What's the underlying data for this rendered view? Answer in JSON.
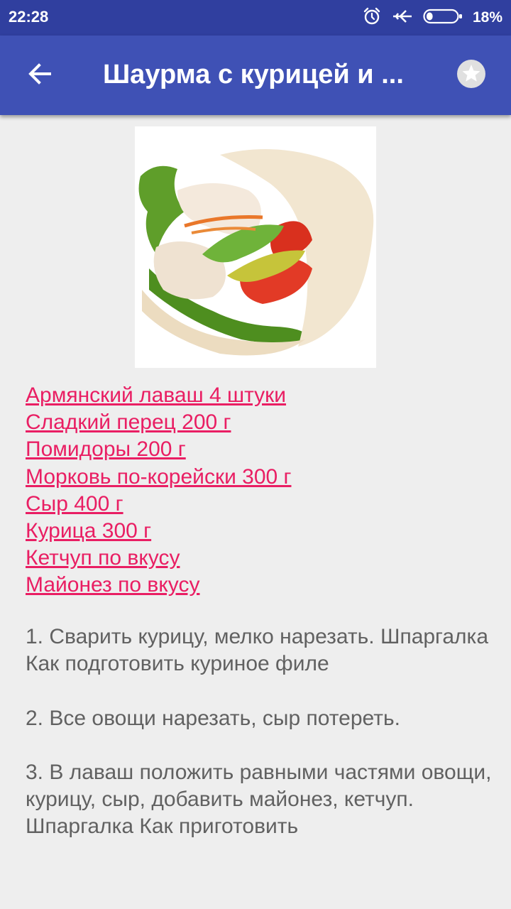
{
  "status_bar": {
    "time": "22:28",
    "battery_percent": "18%",
    "icons": [
      "alarm-icon",
      "airplane-mode-icon",
      "battery-icon"
    ],
    "battery_level": 0.18
  },
  "toolbar": {
    "back_icon": "arrow-back-icon",
    "title": "Шаурма с курицей и ...",
    "favorite_icon": "star-icon"
  },
  "recipe": {
    "image_alt": "shawarma-photo",
    "ingredients": [
      "Армянский лаваш 4 штуки",
      "Сладкий перец 200 г",
      "Помидоры 200 г",
      "Морковь по-корейски 300 г",
      "Сыр 400 г",
      "Курица 300 г",
      "Кетчуп по вкусу",
      "Майонез по вкусу"
    ],
    "steps": [
      "1. Сварить курицу, мелко нарезать. Шпаргалка Как подготовить куриное филе",
      "2. Все овощи нарезать, сыр потереть.",
      "3. В лаваш положить равными частями овощи, курицу, сыр, добавить майонез, кетчуп. Шпаргалка Как приготовить"
    ]
  },
  "colors": {
    "status_bar": "#303f9f",
    "toolbar": "#3f51b5",
    "link": "#e91e63",
    "body_text": "#616161",
    "background": "#eeeeee"
  }
}
